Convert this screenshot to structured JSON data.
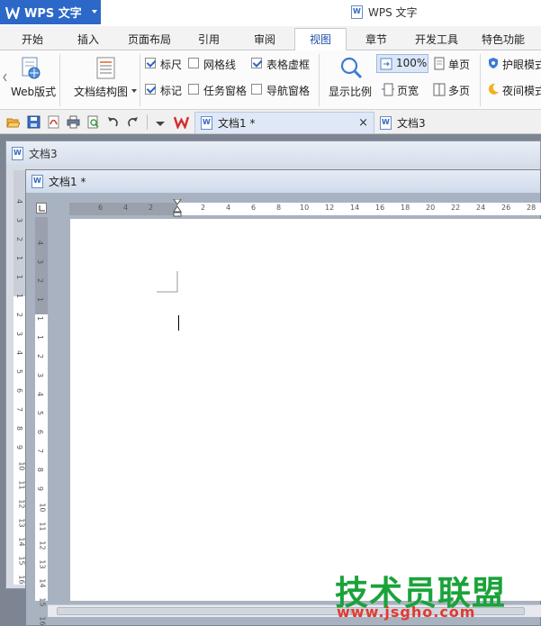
{
  "app": {
    "menu_label": "WPS 文字",
    "window_title": "WPS 文字"
  },
  "tabs": [
    {
      "label": "开始"
    },
    {
      "label": "插入"
    },
    {
      "label": "页面布局"
    },
    {
      "label": "引用"
    },
    {
      "label": "审阅"
    },
    {
      "label": "视图",
      "active": true
    },
    {
      "label": "章节"
    },
    {
      "label": "开发工具"
    },
    {
      "label": "特色功能"
    }
  ],
  "ribbon": {
    "web_layout": "Web版式",
    "doc_map": "文档结构图",
    "show_ratio": "显示比例",
    "checkboxes": [
      {
        "label": "标尺",
        "checked": true
      },
      {
        "label": "网格线",
        "checked": false
      },
      {
        "label": "表格虚框",
        "checked": true
      },
      {
        "label": "标记",
        "checked": true
      },
      {
        "label": "任务窗格",
        "checked": false
      },
      {
        "label": "导航窗格",
        "checked": false
      }
    ],
    "zoom_100": "100%",
    "single_page": "单页",
    "page_width": "页宽",
    "multi_page": "多页",
    "eye_mode": "护眼模式",
    "night_mode": "夜间模式"
  },
  "doc_tabs": [
    {
      "label": "文档1 *",
      "active": true,
      "close": "×"
    },
    {
      "label": "文档3",
      "active": false
    }
  ],
  "windows": {
    "back_title": "文档3",
    "front_title": "文档1 *"
  },
  "h_ruler_labels": [
    "6",
    "4",
    "2",
    "2",
    "4",
    "6",
    "8",
    "10",
    "12",
    "14",
    "16",
    "18",
    "20",
    "22",
    "24",
    "26",
    "28"
  ],
  "v_ruler_labels": [
    "4",
    "3",
    "2",
    "1",
    "1",
    "1",
    "2",
    "3",
    "4",
    "5",
    "6",
    "7",
    "8",
    "9",
    "10",
    "11",
    "12",
    "13",
    "14",
    "15",
    "16"
  ],
  "back_v_ruler_labels": [
    "4",
    "3",
    "2",
    "1",
    "1",
    "1",
    "2",
    "3",
    "4",
    "5",
    "6",
    "7",
    "8",
    "9",
    "10",
    "11",
    "12",
    "13",
    "14",
    "15",
    "16"
  ],
  "watermark": {
    "main": "技术员联盟",
    "url": "www.jsgho.com"
  },
  "colors": {
    "app_blue": "#2c68c8",
    "active_tab_text": "#1c4fa8",
    "watermark_green": "#1aa33a",
    "watermark_red": "#e23a2f"
  }
}
